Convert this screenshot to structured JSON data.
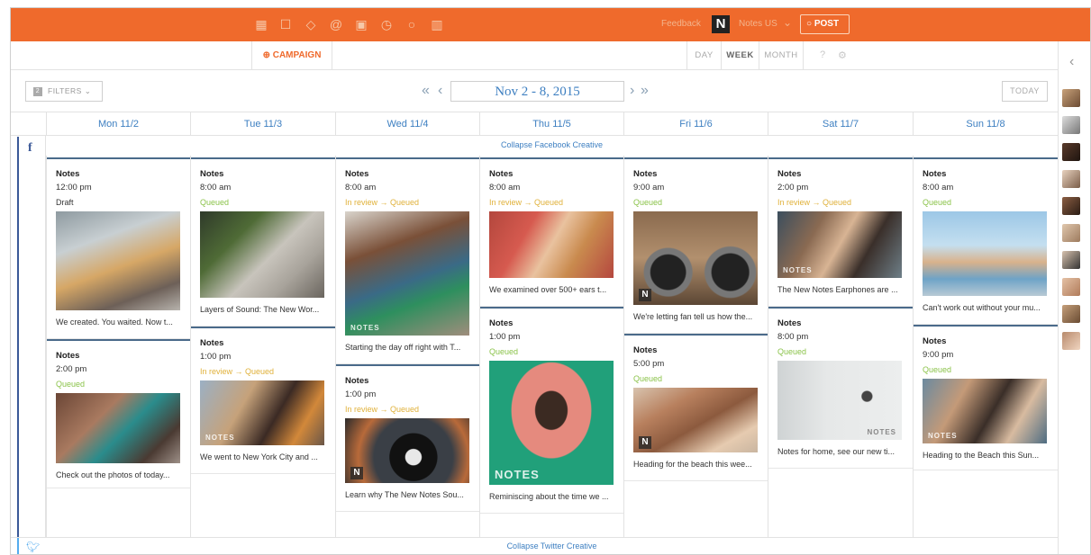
{
  "topbar": {
    "icons": [
      "calendar-icon",
      "edit-icon",
      "drop-icon",
      "at-icon",
      "image-icon",
      "timer-icon",
      "refresh-icon",
      "chart-icon"
    ],
    "feedback": "Feedback",
    "logo": "N",
    "account": "Notes US",
    "post": "POST",
    "brand_color": "#ef6a2c"
  },
  "toolbar": {
    "campaign": "CAMPAIGN",
    "views": [
      "DAY",
      "WEEK",
      "MONTH"
    ],
    "active_view": "WEEK"
  },
  "nav": {
    "filters": "FILTERS",
    "date_range": "Nov 2 - 8, 2015",
    "today": "TODAY"
  },
  "days": [
    "Mon 11/2",
    "Tue 11/3",
    "Wed 11/4",
    "Thu 11/5",
    "Fri 11/6",
    "Sat 11/7",
    "Sun 11/8"
  ],
  "networks": {
    "facebook": {
      "collapse": "Collapse Facebook Creative",
      "color": "#3b5998"
    },
    "twitter": {
      "collapse": "Collapse Twitter Creative",
      "color": "#55acee"
    }
  },
  "columns": [
    {
      "posts": [
        {
          "title": "Notes",
          "time": "12:00 pm",
          "status": "Draft",
          "text": "We created. You waited. Now t..."
        },
        {
          "title": "Notes",
          "time": "2:00 pm",
          "status": "Queued",
          "text": "Check out the photos of today..."
        }
      ]
    },
    {
      "posts": [
        {
          "title": "Notes",
          "time": "8:00 am",
          "status": "Queued",
          "text": "Layers of Sound: The New Wor..."
        },
        {
          "title": "Notes",
          "time": "1:00 pm",
          "status": "In review → Queued",
          "text": "We went to New York City and ..."
        }
      ]
    },
    {
      "posts": [
        {
          "title": "Notes",
          "time": "8:00 am",
          "status": "In review → Queued",
          "text": "Starting the day off right with T..."
        },
        {
          "title": "Notes",
          "time": "1:00 pm",
          "status": "In review → Queued",
          "text": "Learn why The New Notes Sou..."
        }
      ]
    },
    {
      "posts": [
        {
          "title": "Notes",
          "time": "8:00 am",
          "status": "In review → Queued",
          "text": "We examined over 500+ ears t..."
        },
        {
          "title": "Notes",
          "time": "1:00 pm",
          "status": "Queued",
          "text": "Reminiscing about the time we ..."
        }
      ]
    },
    {
      "posts": [
        {
          "title": "Notes",
          "time": "9:00 am",
          "status": "Queued",
          "text": "We're letting fan tell us how the..."
        },
        {
          "title": "Notes",
          "time": "5:00 pm",
          "status": "Queued",
          "text": "Heading for the beach this wee..."
        }
      ]
    },
    {
      "posts": [
        {
          "title": "Notes",
          "time": "2:00 pm",
          "status": "In review → Queued",
          "text": "The New Notes Earphones are ..."
        },
        {
          "title": "Notes",
          "time": "8:00 pm",
          "status": "Queued",
          "text": "Notes for home, see our new ti..."
        }
      ]
    },
    {
      "posts": [
        {
          "title": "Notes",
          "time": "8:00 am",
          "status": "Queued",
          "text": "Can't work out without your mu..."
        },
        {
          "title": "Notes",
          "time": "9:00 pm",
          "status": "Queued",
          "text": "Heading to the Beach this Sun..."
        }
      ]
    }
  ],
  "image_overlays": {
    "notes": "NOTES",
    "n": "N"
  }
}
